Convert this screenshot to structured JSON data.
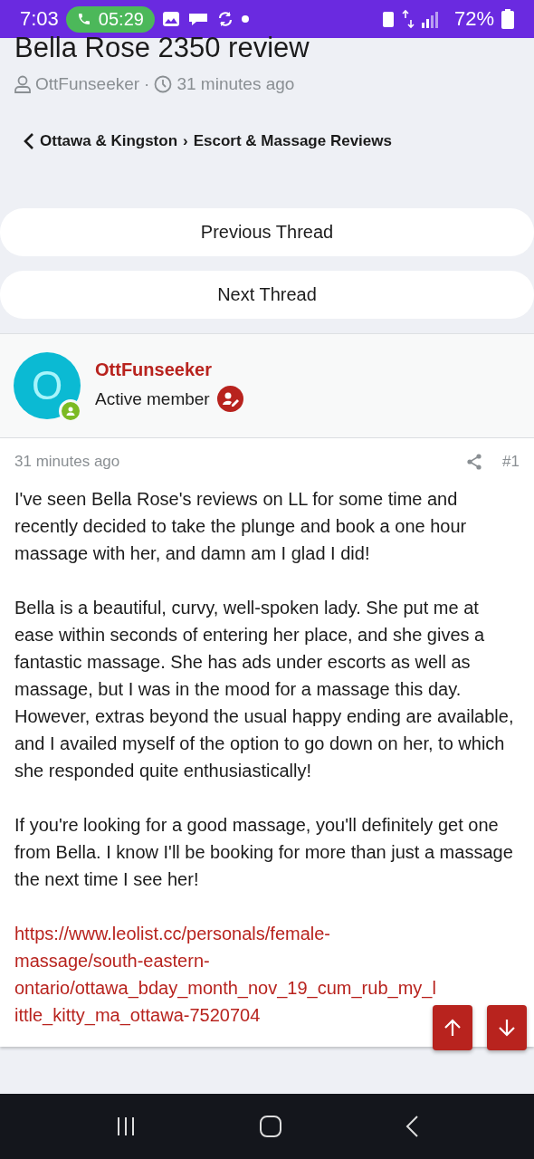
{
  "status_bar": {
    "time": "7:03",
    "call_timer": "05:29",
    "battery": "72%"
  },
  "thread": {
    "title": "Bella Rose 2350 review",
    "author": "OttFunseeker",
    "separator": "·",
    "time": "31 minutes ago"
  },
  "breadcrumb": {
    "parent": "Ottawa & Kingston",
    "separator": "›",
    "current": "Escort & Massage Reviews"
  },
  "nav_buttons": [
    "Previous Thread",
    "Next Thread"
  ],
  "post": {
    "avatar_letter": "O",
    "online": true,
    "username": "OttFunseeker",
    "user_title": "Active member",
    "time": "31 minutes ago",
    "number": "#1",
    "paragraphs": [
      "I've seen Bella Rose's reviews on LL for some time and recently decided to take the plunge and book a one hour massage with her, and damn am I glad I did!",
      "Bella is a beautiful, curvy, well-spoken lady. She put me at ease within seconds of entering her place, and she gives a fantastic massage. She has ads under escorts as well as massage, but I was in the mood for a massage this day. However, extras beyond the usual happy ending are available, and I availed myself of the option to go down on her, to which she responded quite enthusiastically!",
      "If you're looking for a good massage, you'll definitely get one from Bella. I know I'll be booking for more than just a massage the next time I see her!"
    ],
    "link": "https://www.leolist.cc/personals/female-massage/south-eastern-ontario/ottawa_bday_month_nov_19_cum_rub_my_little_kitty_ma_ottawa-7520704"
  }
}
